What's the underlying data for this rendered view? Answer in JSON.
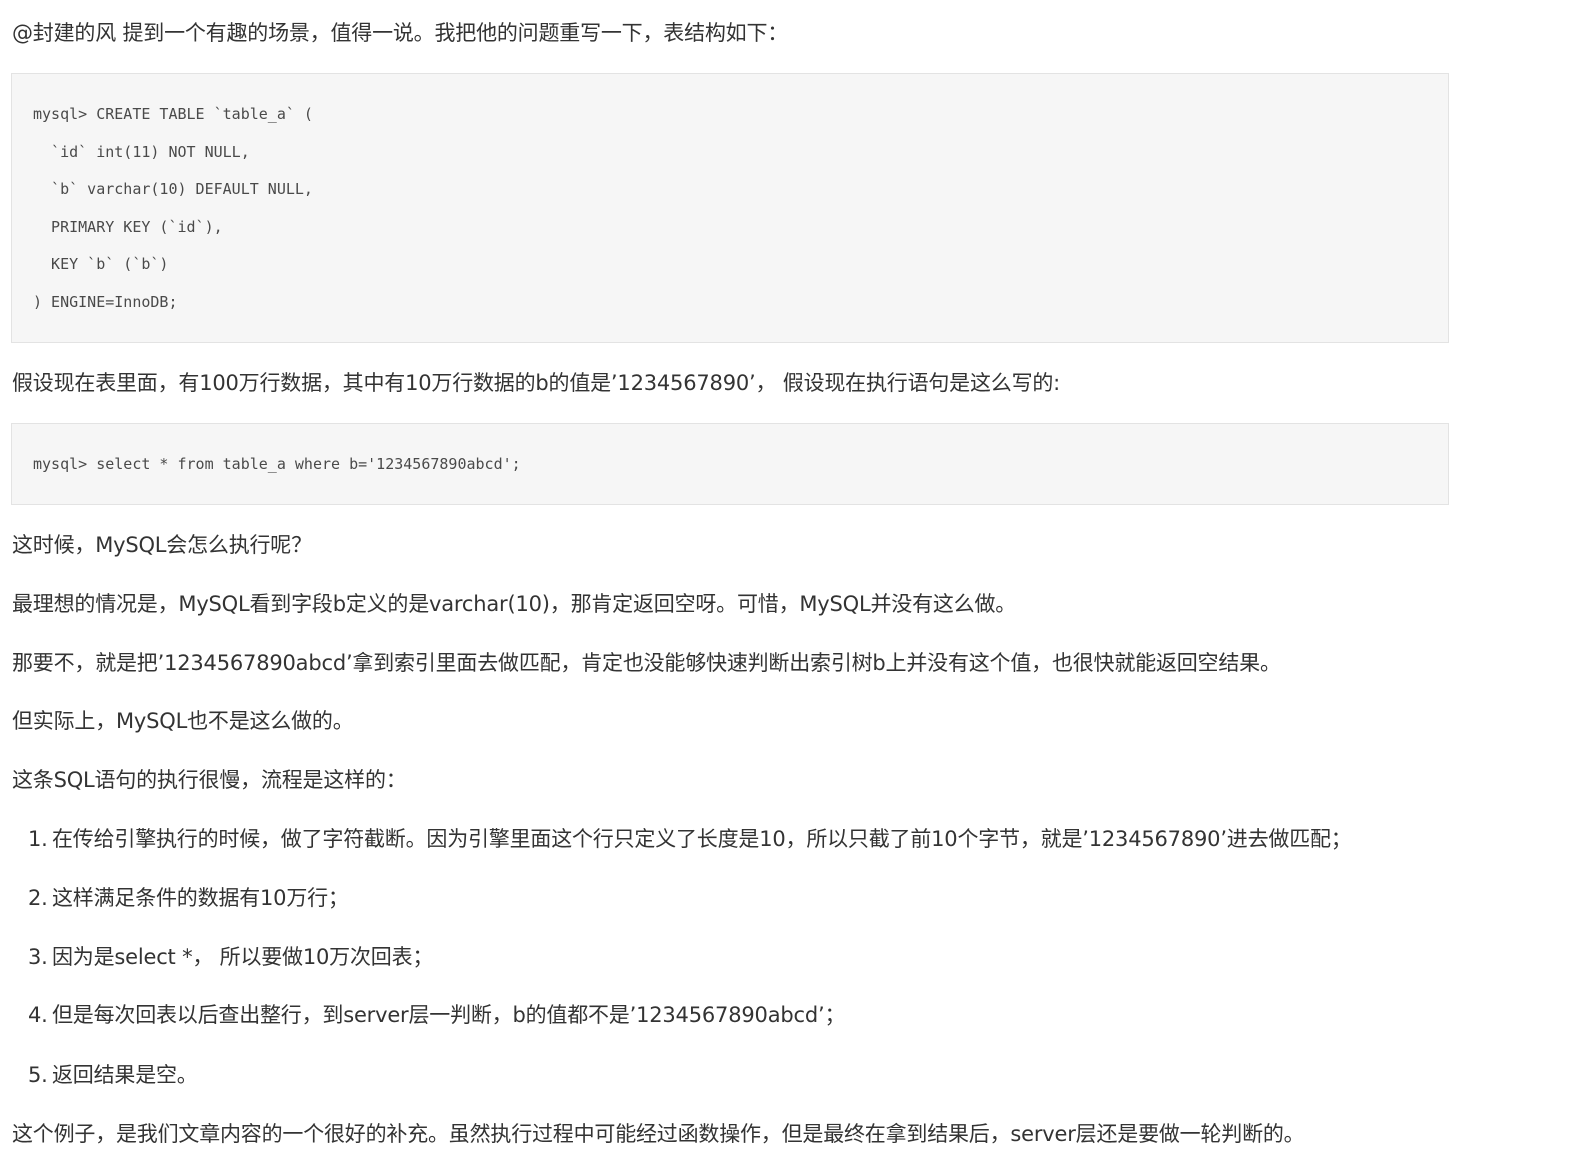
{
  "intro": "@封建的风 提到一个有趣的场景，值得一说。我把他的问题重写一下，表结构如下：",
  "create_code": [
    "mysql> CREATE TABLE `table_a` (",
    "  `id` int(11) NOT NULL,",
    "  `b` varchar(10) DEFAULT NULL,",
    "  PRIMARY KEY (`id`),",
    "  KEY `b` (`b`)",
    ") ENGINE=InnoDB;"
  ],
  "assume": "假设现在表里面，有100万行数据，其中有10万行数据的b的值是’1234567890’， 假设现在执行语句是这么写的:",
  "select_code": "mysql> select * from table_a where b='1234567890abcd';",
  "question": "这时候，MySQL会怎么执行呢？",
  "ideal": "最理想的情况是，MySQL看到字段b定义的是varchar(10)，那肯定返回空呀。可惜，MySQL并没有这么做。",
  "alternative": "那要不，就是把’1234567890abcd’拿到索引里面去做匹配，肯定也没能够快速判断出索引树b上并没有这个值，也很快就能返回空结果。",
  "actual": "但实际上，MySQL也不是这么做的。",
  "flow_intro": "这条SQL语句的执行很慢，流程是这样的：",
  "steps": [
    {
      "num": "1.",
      "text": "在传给引擎执行的时候，做了字符截断。因为引擎里面这个行只定义了长度是10，所以只截了前10个字节，就是’1234567890’进去做匹配；"
    },
    {
      "num": "2.",
      "text": "这样满足条件的数据有10万行；"
    },
    {
      "num": "3.",
      "text": "因为是select *， 所以要做10万次回表；"
    },
    {
      "num": "4.",
      "text": "但是每次回表以后查出整行，到server层一判断，b的值都不是’1234567890abcd’；"
    },
    {
      "num": "5.",
      "text": "返回结果是空。"
    }
  ],
  "conclusion": "这个例子，是我们文章内容的一个很好的补充。虽然执行过程中可能经过函数操作，但是最终在拿到结果后，server层还是要做一轮判断的。"
}
